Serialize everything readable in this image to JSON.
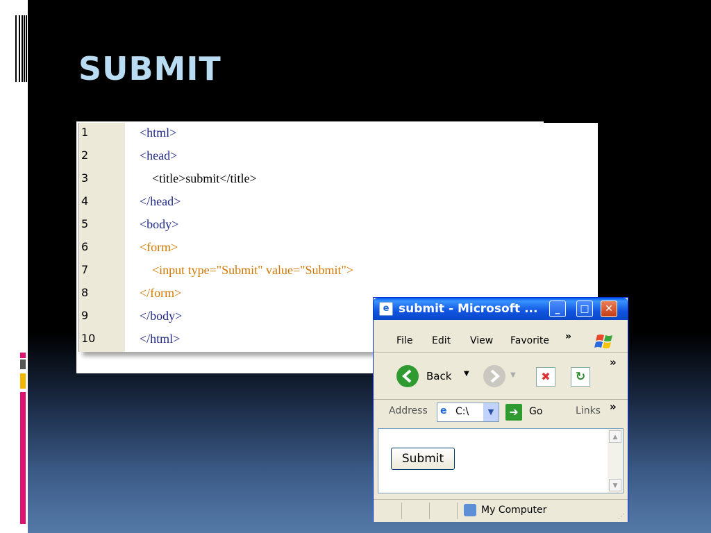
{
  "slide": {
    "title": "SUBMIT",
    "accent_colors": [
      "#e0126f",
      "#555555",
      "#f2b800",
      "#e0126f"
    ]
  },
  "code": {
    "line_numbers": [
      "1",
      "2",
      "3",
      "4",
      "5",
      "6",
      "7",
      "8",
      "9",
      "10"
    ],
    "lines": [
      "<html>",
      "<head>",
      "    <title>submit</title>",
      "</head>",
      "<body>",
      "<form>",
      "    <input type=\"Submit\" value=\"Submit\">",
      "</form>",
      "</body>",
      "</html>"
    ]
  },
  "browser": {
    "title": "submit - Microsoft ...",
    "menu": [
      "File",
      "Edit",
      "View",
      "Favorite"
    ],
    "menu_more": "»",
    "back_label": "Back",
    "toolbar_more": "»",
    "address_label": "Address",
    "address_value": "C:\\",
    "go_label": "Go",
    "links_label": "Links",
    "links_more": "»",
    "submit_button": "Submit",
    "status_zone": "My Computer"
  }
}
